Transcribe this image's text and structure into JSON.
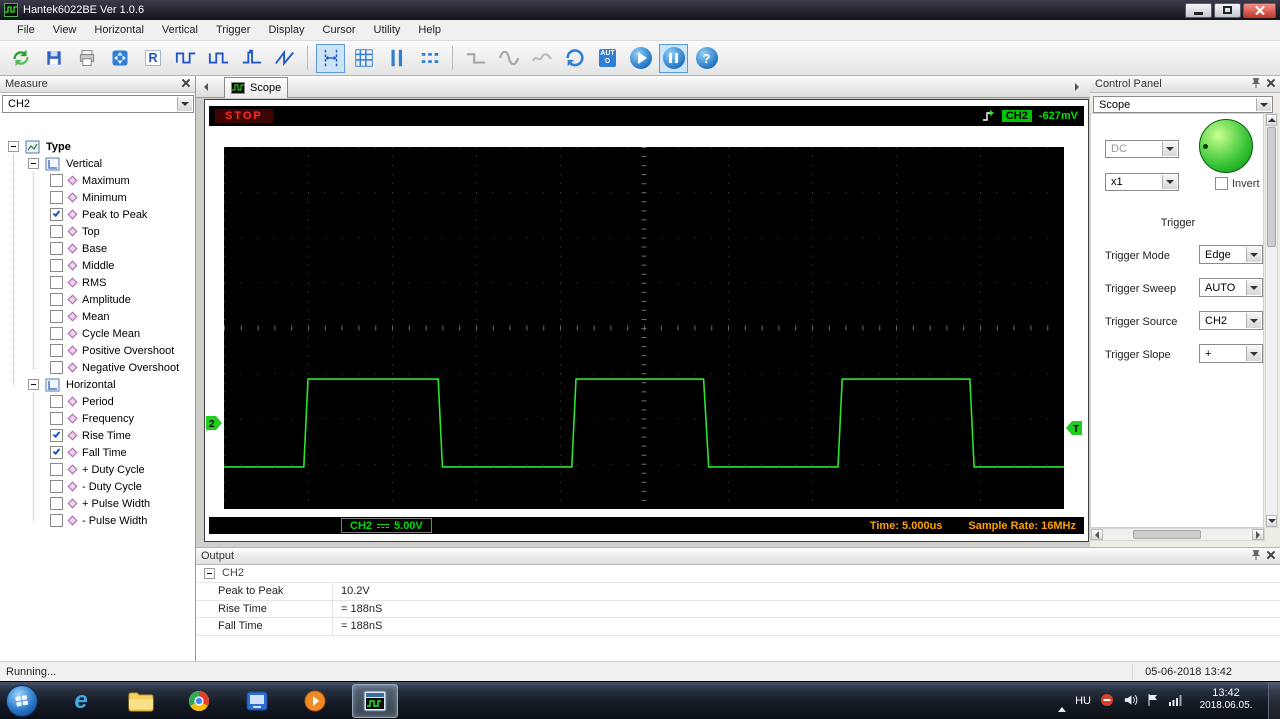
{
  "window": {
    "title": "Hantek6022BE Ver 1.0.6"
  },
  "menu": {
    "items": [
      {
        "label": "File"
      },
      {
        "label": "View"
      },
      {
        "label": "Horizontal"
      },
      {
        "label": "Vertical"
      },
      {
        "label": "Trigger"
      },
      {
        "label": "Display"
      },
      {
        "label": "Cursor"
      },
      {
        "label": "Utility"
      },
      {
        "label": "Help"
      }
    ]
  },
  "toolbar": {
    "r_glyph": "R",
    "auto_glyph": "AUTO",
    "help_glyph": "?"
  },
  "measure": {
    "title": "Measure",
    "channel_select": "CH2",
    "root_label": "Type",
    "groups": [
      {
        "label": "Vertical",
        "items": [
          {
            "label": "Maximum",
            "checked": false
          },
          {
            "label": "Minimum",
            "checked": false
          },
          {
            "label": "Peak to Peak",
            "checked": true
          },
          {
            "label": "Top",
            "checked": false
          },
          {
            "label": "Base",
            "checked": false
          },
          {
            "label": "Middle",
            "checked": false
          },
          {
            "label": "RMS",
            "checked": false
          },
          {
            "label": "Amplitude",
            "checked": false
          },
          {
            "label": "Mean",
            "checked": false
          },
          {
            "label": "Cycle Mean",
            "checked": false
          },
          {
            "label": "Positive Overshoot",
            "checked": false
          },
          {
            "label": "Negative Overshoot",
            "checked": false
          }
        ]
      },
      {
        "label": "Horizontal",
        "items": [
          {
            "label": "Period",
            "checked": false
          },
          {
            "label": "Frequency",
            "checked": false
          },
          {
            "label": "Rise Time",
            "checked": true
          },
          {
            "label": "Fall Time",
            "checked": true
          },
          {
            "label": "+ Duty Cycle",
            "checked": false
          },
          {
            "label": "- Duty Cycle",
            "checked": false
          },
          {
            "label": "+ Pulse Width",
            "checked": false
          },
          {
            "label": "- Pulse Width",
            "checked": false
          }
        ]
      }
    ]
  },
  "tabs": {
    "scope_label": "Scope"
  },
  "scope": {
    "run_state": "STOP",
    "trigger_channel": "CH2",
    "trigger_level": "-627mV",
    "channel_label": "CH2",
    "volts_per_div": "5.00V",
    "time_label": "Time: 5.000us",
    "sample_rate_label": "Sample Rate: 16MHz",
    "left_marker": "2",
    "right_marker": "T"
  },
  "control_panel": {
    "title": "Control Panel",
    "panel_select": "Scope",
    "coupling": "DC",
    "attenuation": "x1",
    "invert_label": "Invert",
    "trigger_section_label": "Trigger",
    "trigger_rows": [
      {
        "label": "Trigger Mode",
        "value": "Edge"
      },
      {
        "label": "Trigger Sweep",
        "value": "AUTO"
      },
      {
        "label": "Trigger Source",
        "value": "CH2"
      },
      {
        "label": "Trigger Slope",
        "value": "+"
      }
    ]
  },
  "output": {
    "title": "Output",
    "group_label": "CH2",
    "rows": [
      {
        "label": "Peak to Peak",
        "value": "10.2V"
      },
      {
        "label": "Rise Time",
        "value": "= 188nS"
      },
      {
        "label": "Fall Time",
        "value": "= 188nS"
      }
    ]
  },
  "status_bar": {
    "left": "Running...",
    "right": "05-06-2018 13:42"
  },
  "taskbar": {
    "ie_glyph": "e",
    "lang": "HU",
    "clock_time": "13:42",
    "clock_date": "2018.06.05."
  },
  "chart_data": {
    "type": "line",
    "title": "Oscilloscope CH2 square wave",
    "x_divisions": 10,
    "y_divisions": 8,
    "time_per_div": "5.000us",
    "volts_per_div": "5.00V",
    "sample_rate": "16MHz",
    "trigger_level": "-627mV",
    "measurements": {
      "peak_to_peak": "10.2V",
      "rise_time": "= 188nS",
      "fall_time": "= 188nS"
    },
    "series": [
      {
        "name": "CH2",
        "color": "#2be52b",
        "points_div": [
          [
            0,
            7.07
          ],
          [
            0.95,
            7.07
          ],
          [
            1.0,
            5.13
          ],
          [
            2.55,
            5.13
          ],
          [
            2.6,
            7.07
          ],
          [
            4.14,
            7.07
          ],
          [
            4.19,
            5.13
          ],
          [
            5.71,
            5.13
          ],
          [
            5.77,
            7.07
          ],
          [
            7.31,
            7.07
          ],
          [
            7.36,
            5.13
          ],
          [
            8.88,
            5.13
          ],
          [
            8.93,
            7.07
          ],
          [
            10,
            7.07
          ]
        ]
      }
    ]
  }
}
